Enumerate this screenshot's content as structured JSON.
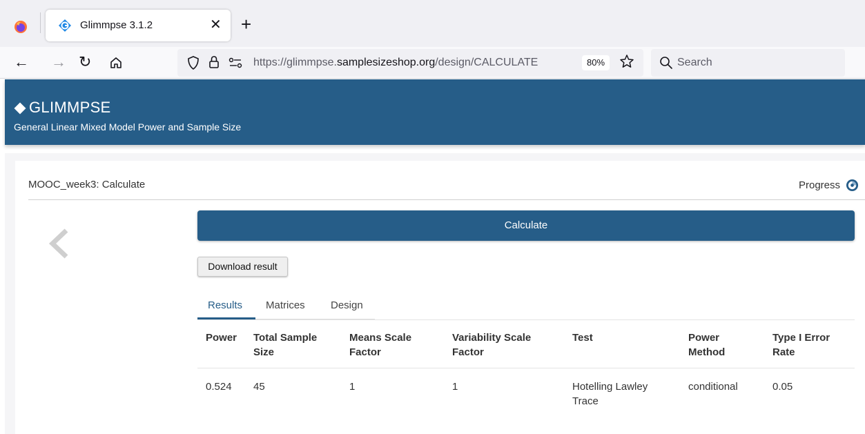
{
  "browser": {
    "tab_title": "Glimmpse 3.1.2",
    "tab_close": "✕",
    "new_tab": "+",
    "nav": {
      "back": "←",
      "forward": "→",
      "reload": "↻"
    },
    "url_prefix": "https://glimmpse.",
    "url_domain": "samplesizeshop.org",
    "url_path": "/design/CALCULATE",
    "zoom": "80%",
    "search_placeholder": "Search"
  },
  "app": {
    "title": "GLIMMPSE",
    "subtitle": "General Linear Mixed Model Power and Sample Size"
  },
  "page": {
    "breadcrumb": "MOOC_week3: Calculate",
    "progress_label": "Progress",
    "calculate_label": "Calculate",
    "download_label": "Download result"
  },
  "tabs": [
    {
      "label": "Results",
      "active": true
    },
    {
      "label": "Matrices",
      "active": false
    },
    {
      "label": "Design",
      "active": false
    }
  ],
  "results_table": {
    "headers": [
      "Power",
      "Total Sample Size",
      "Means Scale Factor",
      "Variability Scale Factor",
      "Test",
      "Power Method",
      "Type I Error Rate"
    ],
    "rows": [
      [
        "0.524",
        "45",
        "1",
        "1",
        "Hotelling Lawley Trace",
        "conditional",
        "0.05"
      ]
    ]
  },
  "colors": {
    "brand": "#265d88",
    "browser_chrome": "#f0f0f4"
  },
  "icons": [
    "firefox-logo",
    "glimmpse-favicon",
    "shield-icon",
    "lock-icon",
    "permissions-icon",
    "bookmark-star-icon",
    "search-icon",
    "home-icon",
    "progress-icon",
    "chevron-left-icon"
  ]
}
